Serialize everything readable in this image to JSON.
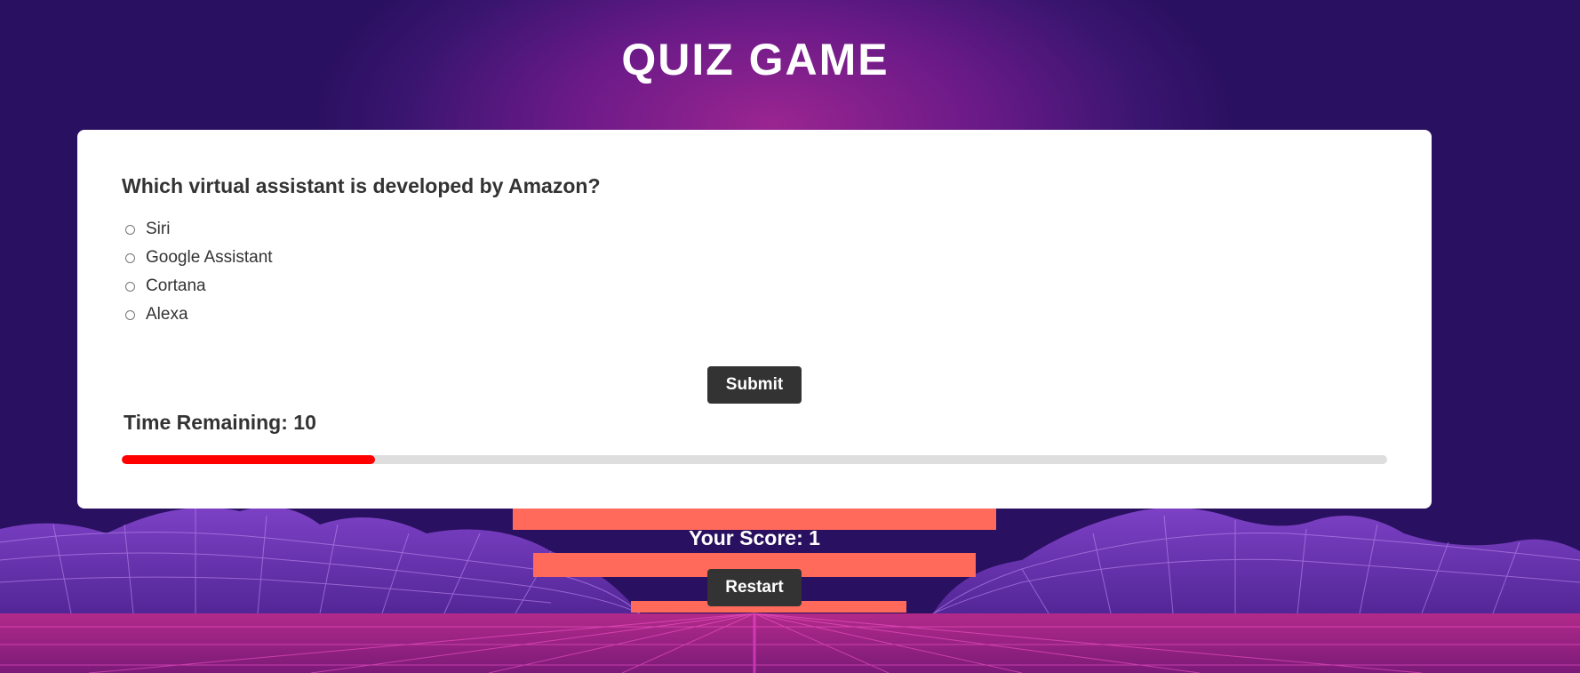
{
  "header": {
    "title": "QUIZ GAME"
  },
  "quiz": {
    "question": "Which virtual assistant is developed by Amazon?",
    "options": [
      {
        "label": "Siri",
        "selected": false
      },
      {
        "label": "Google Assistant",
        "selected": false
      },
      {
        "label": "Cortana",
        "selected": false
      },
      {
        "label": "Alexa",
        "selected": false
      }
    ],
    "submit_label": "Submit",
    "timer_text": "Time Remaining: 10",
    "time_progress_fraction": 0.2
  },
  "footer": {
    "score_text": "Your Score: 1",
    "restart_label": "Restart"
  },
  "colors": {
    "progress_fill": "#ff0000",
    "progress_track": "#dedede",
    "button_bg": "#333333",
    "card_bg": "#ffffff",
    "accent_neon": "#ff6a5a"
  }
}
